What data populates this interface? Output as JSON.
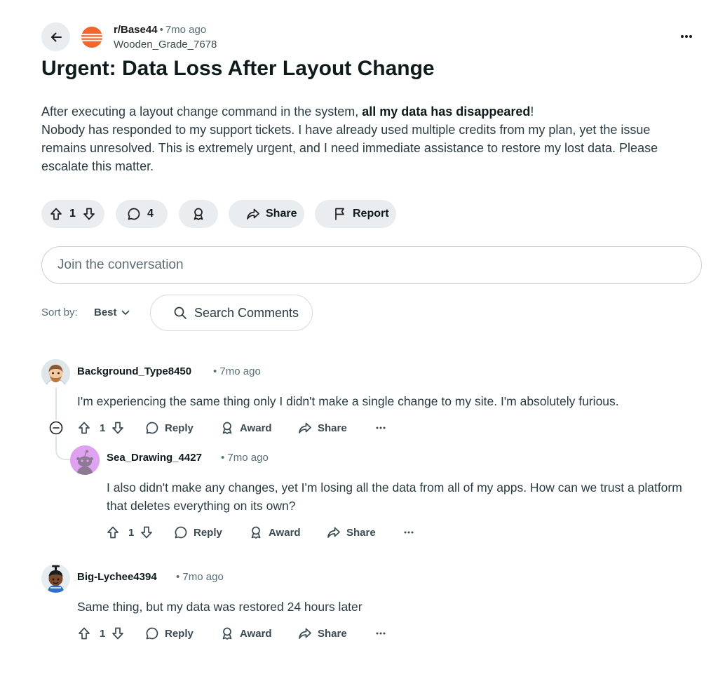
{
  "colors": {
    "background": "#ffffff",
    "pill_bg": "#e9edf0",
    "text_primary": "#0f1a1c",
    "text_secondary": "#576f76",
    "subreddit_icon": "#f0662e"
  },
  "header": {
    "back_icon": "arrow-left-icon",
    "subreddit": "r/Base44",
    "time": "7mo ago",
    "author": "Wooden_Grade_7678",
    "more_icon": "ellipsis-icon"
  },
  "post": {
    "title": "Urgent: Data Loss After Layout Change",
    "body_line1_prefix": "After executing a layout change command in the system, ",
    "body_line1_bold": "all my data has disappeared",
    "body_line1_suffix": "!",
    "body_rest": "Nobody has responded to my support tickets. I have already used multiple credits from my plan, yet the issue remains unresolved. This is extremely urgent, and I need immediate assistance to restore my lost data. Please escalate this matter."
  },
  "actions": {
    "vote_count": "1",
    "comment_count": "4",
    "share_label": "Share",
    "report_label": "Report"
  },
  "join": {
    "placeholder": "Join the conversation"
  },
  "sort": {
    "label": "Sort by:",
    "value": "Best",
    "search_label": "Search Comments"
  },
  "comments": [
    {
      "author": "Background_Type8450",
      "time": "7mo ago",
      "body": "I'm experiencing the same thing only I didn't make a single change to my site. I'm absolutely furious.",
      "votes": "1",
      "reply_label": "Reply",
      "award_label": "Award",
      "share_label": "Share"
    },
    {
      "author": "Sea_Drawing_4427",
      "time": "7mo ago",
      "body": "I also didn't make any changes, yet I'm losing all the data from all of my apps. How can we trust a platform that deletes everything on its own?",
      "votes": "1",
      "reply_label": "Reply",
      "award_label": "Award",
      "share_label": "Share"
    },
    {
      "author": "Big-Lychee4394",
      "time": "7mo ago",
      "body": "Same thing, but my data was restored 24 hours later",
      "votes": "1",
      "reply_label": "Reply",
      "award_label": "Award",
      "share_label": "Share"
    }
  ]
}
